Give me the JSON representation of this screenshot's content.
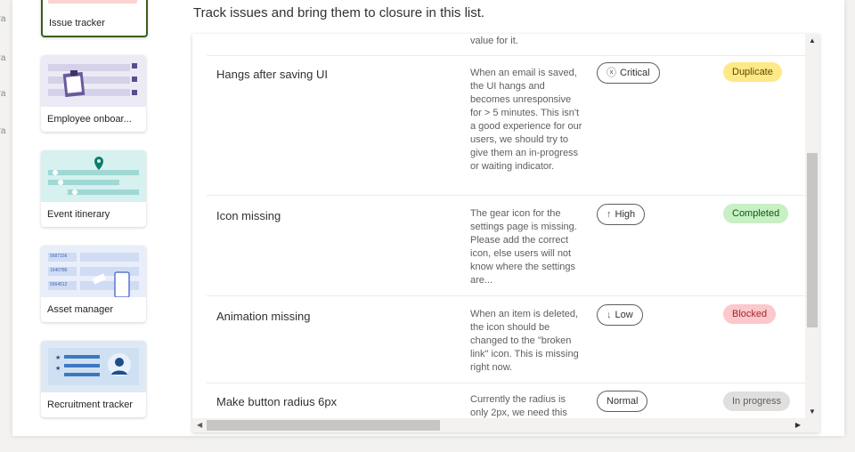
{
  "background_text": [
    "ora",
    "ora",
    "ora",
    "ora"
  ],
  "description": "Track issues and bring them to closure in this list.",
  "templates": [
    {
      "label": "Issue tracker",
      "selected": true
    },
    {
      "label": "Employee onboar...",
      "selected": false
    },
    {
      "label": "Event itinerary",
      "selected": false
    },
    {
      "label": "Asset manager",
      "selected": false
    },
    {
      "label": "Recruitment tracker",
      "selected": false
    }
  ],
  "asset_numbers": [
    "5687156",
    "1640786",
    "5564512"
  ],
  "partial_row_text": "value for it.",
  "rows": [
    {
      "title": "Hangs after saving UI",
      "description": "When an email is saved, the UI hangs and becomes unresponsive for > 5 minutes. This isn't a good experience for our users, we should try to give them an in-progress or waiting indicator.",
      "priority": "Critical",
      "priority_icon": "ⓧ",
      "status": "Duplicate",
      "status_bg": "#fce100",
      "status_bg_soft": "#fdf0a8"
    },
    {
      "title": "Icon missing",
      "description": "The gear icon for the settings page is missing. Please add the correct icon, else users will not know where the settings are...",
      "priority": "High",
      "priority_icon": "↑",
      "status": "Completed",
      "status_bg_soft": "#c7f0c4"
    },
    {
      "title": "Animation missing",
      "description": "When an item is deleted, the icon should be changed to the \"broken link\" icon. This is missing right now.",
      "priority": "Low",
      "priority_icon": "↓",
      "status": "Blocked",
      "status_bg_soft": "#fbc8cc"
    },
    {
      "title": "Make button radius 6px",
      "description": "Currently the radius is only 2px, we need this",
      "priority": "Normal",
      "priority_icon": "",
      "status": "In progress",
      "status_bg_soft": "#e1dfdd"
    }
  ],
  "colors": {
    "accent": "#3b5e1c",
    "completed_text": "#0b5a08",
    "blocked_text": "#a4262c",
    "duplicate_text": "#5c4a00",
    "inprogress_text": "#605e5c"
  }
}
